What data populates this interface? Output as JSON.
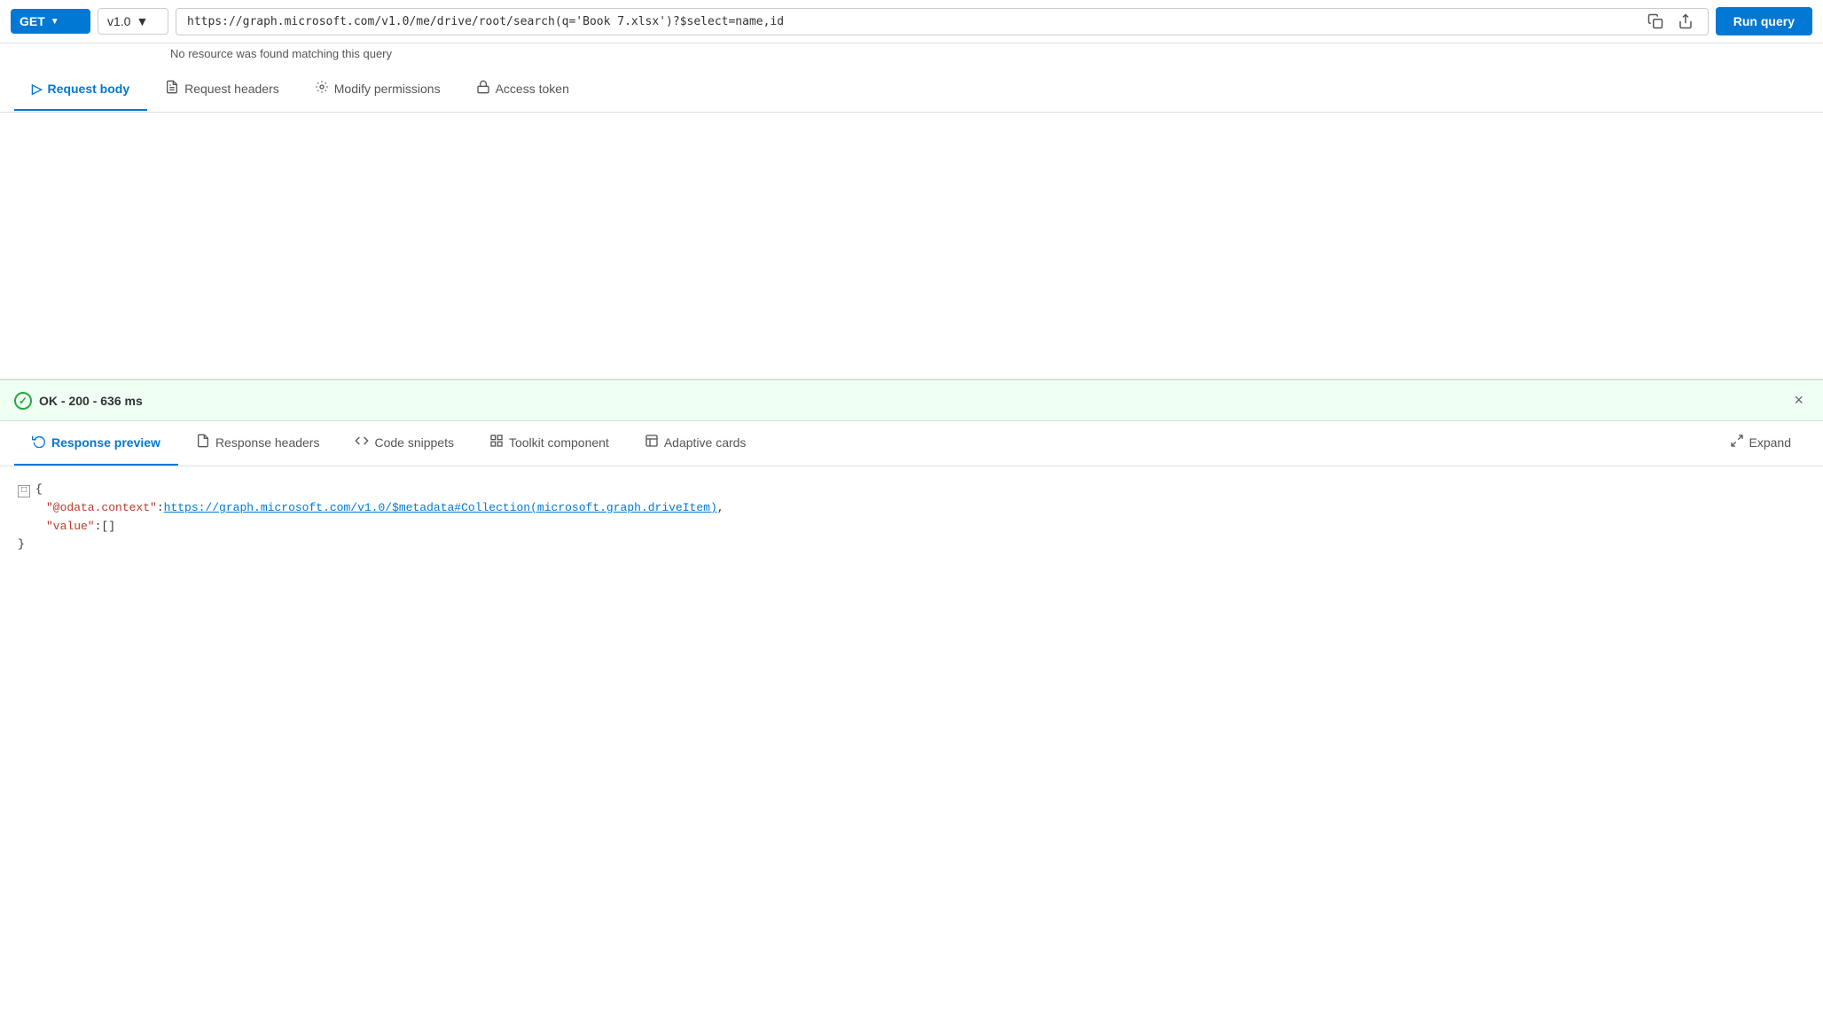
{
  "topbar": {
    "method": "GET",
    "method_chevron": "▼",
    "version": "v1.0",
    "version_chevron": "▼",
    "url": "https://graph.microsoft.com/v1.0/me/drive/root/search(q='Book 7.xlsx')?$select=name,id",
    "no_resource_msg": "No resource was found matching this query",
    "copy_icon": "📄",
    "share_icon": "↗",
    "run_query_label": "Run query"
  },
  "request_tabs": [
    {
      "id": "request-body",
      "label": "Request body",
      "icon": "▷",
      "active": true
    },
    {
      "id": "request-headers",
      "label": "Request headers",
      "icon": "📋"
    },
    {
      "id": "modify-permissions",
      "label": "Modify permissions",
      "icon": "⚙"
    },
    {
      "id": "access-token",
      "label": "Access token",
      "icon": "🔒"
    }
  ],
  "response_status": {
    "status_label": "OK",
    "status_code": "200",
    "duration": "636 ms",
    "full_text": "OK - 200 - 636 ms",
    "close_icon": "×"
  },
  "response_tabs": [
    {
      "id": "response-preview",
      "label": "Response preview",
      "icon": "↩",
      "active": true
    },
    {
      "id": "response-headers",
      "label": "Response headers",
      "icon": "📋"
    },
    {
      "id": "code-snippets",
      "label": "Code snippets",
      "icon": "📤"
    },
    {
      "id": "toolkit-component",
      "label": "Toolkit component",
      "icon": "🔲"
    },
    {
      "id": "adaptive-cards",
      "label": "Adaptive cards",
      "icon": "🖼"
    },
    {
      "id": "expand",
      "label": "Expand",
      "icon": "⤢"
    }
  ],
  "response_json": {
    "context_key": "\"@odata.context\"",
    "context_value": "\"https://graph.microsoft.com/v1.0/$metadata#Collection(microsoft.graph.driveItem)\"",
    "context_url": "https://graph.microsoft.com/v1.0/$metadata#Collection(microsoft.graph.driveItem)",
    "value_key": "\"value\"",
    "value_val": "[]"
  }
}
